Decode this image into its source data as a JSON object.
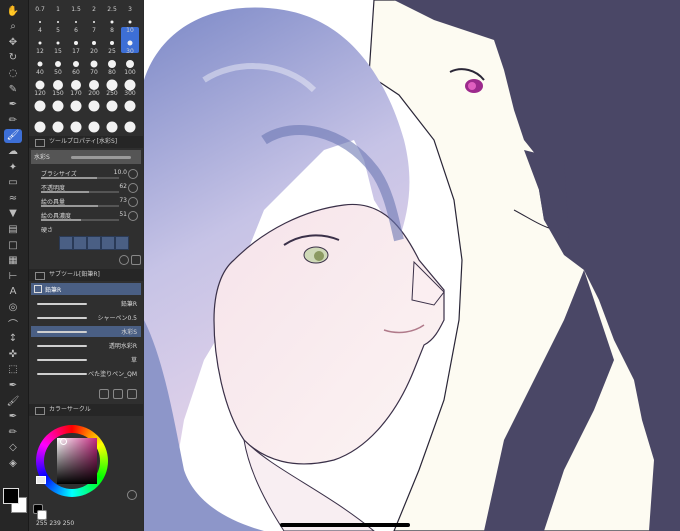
{
  "brush_sizes": [
    {
      "label": "0.7",
      "size": 2
    },
    {
      "label": "1",
      "size": 2
    },
    {
      "label": "1.5",
      "size": 2
    },
    {
      "label": "2",
      "size": 2
    },
    {
      "label": "2.5",
      "size": 3
    },
    {
      "label": "3",
      "size": 3
    },
    {
      "label": "4",
      "size": 3
    },
    {
      "label": "5",
      "size": 3
    },
    {
      "label": "6",
      "size": 4
    },
    {
      "label": "7",
      "size": 4
    },
    {
      "label": "8",
      "size": 4
    },
    {
      "label": "10",
      "size": 5,
      "selected": true
    },
    {
      "label": "12",
      "size": 5
    },
    {
      "label": "15",
      "size": 6
    },
    {
      "label": "17",
      "size": 6
    },
    {
      "label": "20",
      "size": 7
    },
    {
      "label": "25",
      "size": 8
    },
    {
      "label": "30",
      "size": 8
    },
    {
      "label": "40",
      "size": 9
    },
    {
      "label": "50",
      "size": 10
    },
    {
      "label": "60",
      "size": 10
    },
    {
      "label": "70",
      "size": 10
    },
    {
      "label": "80",
      "size": 11
    },
    {
      "label": "100",
      "size": 11
    },
    {
      "label": "120",
      "size": 11
    },
    {
      "label": "150",
      "size": 11
    },
    {
      "label": "170",
      "size": 11
    },
    {
      "label": "200",
      "size": 11
    },
    {
      "label": "250",
      "size": 11
    },
    {
      "label": "300",
      "size": 11
    },
    {
      "label": "",
      "size": 11
    },
    {
      "label": "",
      "size": 11
    },
    {
      "label": "",
      "size": 11
    },
    {
      "label": "",
      "size": 11
    },
    {
      "label": "",
      "size": 11
    },
    {
      "label": "",
      "size": 11
    }
  ],
  "tool_property": {
    "title": "ツールプロパティ[水彩S]",
    "brush_name": "水彩S",
    "rows": [
      {
        "name": "ブラシサイズ",
        "value": "10.0",
        "fill": 0.72
      },
      {
        "name": "不透明度",
        "value": "62",
        "fill": 0.62
      },
      {
        "name": "絵の具量",
        "value": "73",
        "fill": 0.73
      },
      {
        "name": "絵の具濃度",
        "value": "51",
        "fill": 0.51
      }
    ],
    "hardness_label": "硬さ"
  },
  "sub_tool": {
    "title": "サブツール[鉛筆R]",
    "group": "鉛筆R",
    "items": [
      {
        "name": "鉛筆R",
        "selected": false
      },
      {
        "name": "シャーペン0.5",
        "selected": false
      },
      {
        "name": "水彩S",
        "selected": true
      },
      {
        "name": "透明水彩R",
        "selected": false
      },
      {
        "name": "草",
        "selected": false
      },
      {
        "name": "べた塗りペン_QM",
        "selected": false
      }
    ]
  },
  "color_circle": {
    "title": "カラーサークル",
    "rgb_text": "255 239 250",
    "main_color": "#000000",
    "sub_color": "#ffffff"
  },
  "tools": [
    "hand-icon",
    "zoom-icon",
    "move-icon",
    "rotate-icon",
    "lasso-icon",
    "eyedropper-icon",
    "pen-icon",
    "pencil-icon",
    "brush-icon",
    "airbrush-icon",
    "decoration-icon",
    "eraser-icon",
    "blend-icon",
    "fill-icon",
    "gradient-icon",
    "figure-icon",
    "frame-icon",
    "ruler-icon",
    "text-icon",
    "balloon-icon",
    "correct-line-icon",
    "layer-move-icon",
    "object-icon",
    "select-icon",
    "pen2-icon",
    "brush2-icon",
    "pen3-icon",
    "pencil2-icon",
    "shape-icon",
    "fill2-icon"
  ]
}
